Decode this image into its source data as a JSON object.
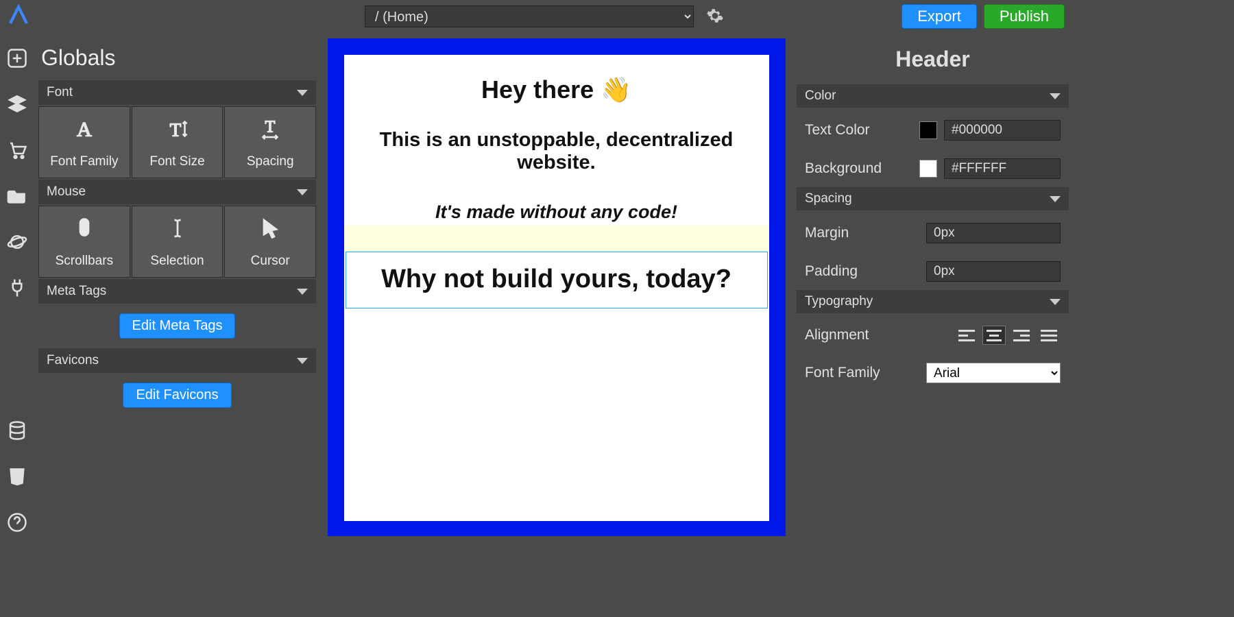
{
  "topbar": {
    "page_selector_value": "/ (Home)",
    "export_label": "Export",
    "publish_label": "Publish"
  },
  "left": {
    "title": "Globals",
    "sections": {
      "font": {
        "label": "Font",
        "tiles": [
          "Font Family",
          "Font Size",
          "Spacing"
        ]
      },
      "mouse": {
        "label": "Mouse",
        "tiles": [
          "Scrollbars",
          "Selection",
          "Cursor"
        ]
      },
      "meta": {
        "label": "Meta Tags",
        "button": "Edit Meta Tags"
      },
      "favicons": {
        "label": "Favicons",
        "button": "Edit Favicons"
      }
    }
  },
  "canvas": {
    "h1": "Hey there 👋",
    "h2": "This is an unstoppable, decentralized website.",
    "h3": "It's made without any code!",
    "h4": "Why not build yours, today?"
  },
  "right": {
    "title": "Header",
    "color_section": "Color",
    "text_color_label": "Text Color",
    "text_color_value": "#000000",
    "bg_label": "Background",
    "bg_value": "#FFFFFF",
    "spacing_section": "Spacing",
    "margin_label": "Margin",
    "margin_value": "0px",
    "padding_label": "Padding",
    "padding_value": "0px",
    "typo_section": "Typography",
    "alignment_label": "Alignment",
    "ff_label": "Font Family",
    "ff_value": "Arial"
  }
}
